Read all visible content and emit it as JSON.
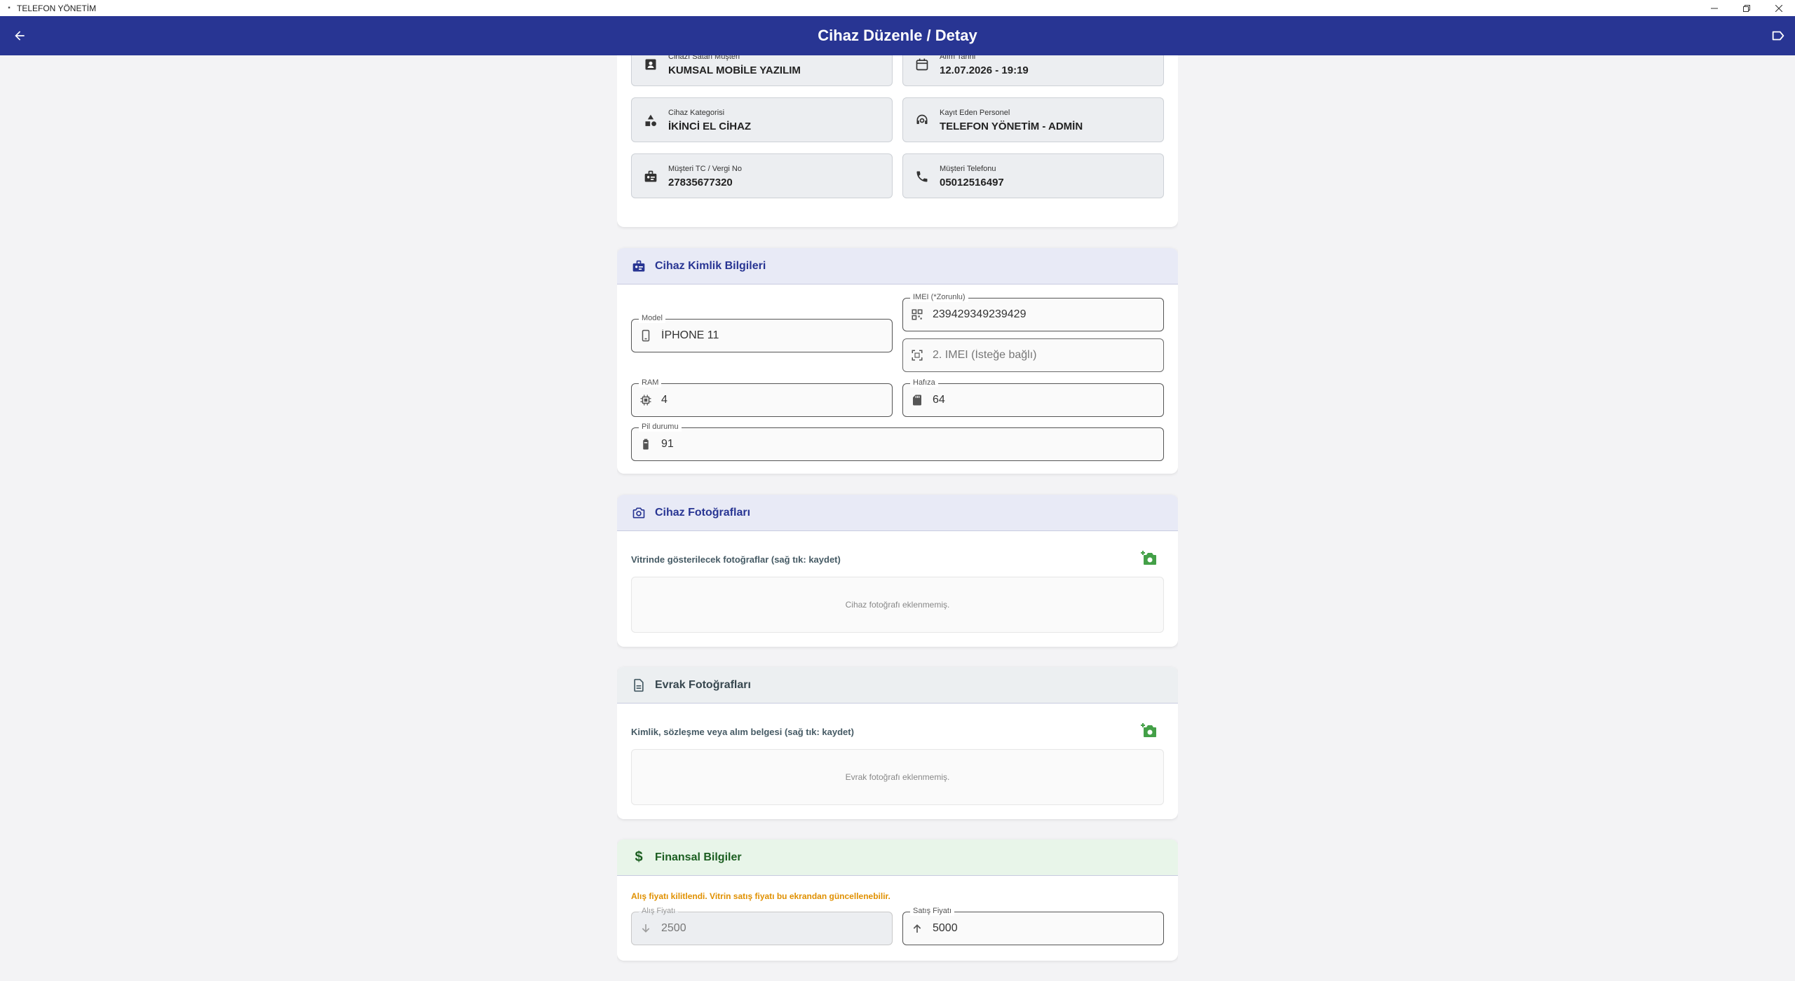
{
  "window": {
    "title": "TELEFON YÖNETİM"
  },
  "appbar": {
    "title": "Cihaz Düzenle / Detay"
  },
  "customer_info": [
    {
      "label": "Cihazı Satan Müşteri",
      "value": "KUMSAL MOBİLE YAZILIM",
      "icon": "contact-card-icon"
    },
    {
      "label": "Alım Tarihi",
      "value": "12.07.2026 - 19:19",
      "icon": "calendar-icon"
    },
    {
      "label": "Cihaz Kategorisi",
      "value": "İKİNCİ EL CİHAZ",
      "icon": "category-icon"
    },
    {
      "label": "Kayıt Eden Personel",
      "value": "TELEFON YÖNETİM - ADMİN",
      "icon": "support-agent-icon"
    },
    {
      "label": "Müşteri TC / Vergi No",
      "value": "27835677320",
      "icon": "id-badge-icon"
    },
    {
      "label": "Müşteri Telefonu",
      "value": "05012516497",
      "icon": "phone-icon"
    }
  ],
  "identity": {
    "title": "Cihaz Kimlik Bilgileri",
    "model": {
      "label": "Model",
      "value": "İPHONE 11"
    },
    "imei1": {
      "label": "IMEI (*Zorunlu)",
      "value": "239429349239429"
    },
    "imei2": {
      "placeholder": "2. IMEI (İsteğe bağlı)"
    },
    "ram": {
      "label": "RAM",
      "value": "4"
    },
    "storage": {
      "label": "Hafıza",
      "value": "64"
    },
    "battery": {
      "label": "Pil durumu",
      "value": "91"
    }
  },
  "device_photos": {
    "title": "Cihaz Fotoğrafları",
    "subtitle": "Vitrinde gösterilecek fotoğraflar (sağ tık: kaydet)",
    "empty": "Cihaz fotoğrafı eklenmemiş."
  },
  "document_photos": {
    "title": "Evrak Fotoğrafları",
    "subtitle": "Kimlik, sözleşme veya alım belgesi (sağ tık: kaydet)",
    "empty": "Evrak fotoğrafı eklenmemiş."
  },
  "finance": {
    "title": "Finansal Bilgiler",
    "warning": "Alış fiyatı kilitlendi. Vitrin satış fiyatı bu ekrandan güncellenebilir.",
    "buy": {
      "label": "Alış Fiyatı",
      "value": "2500"
    },
    "sell": {
      "label": "Satış Fiyatı",
      "value": "5000"
    }
  },
  "colors": {
    "primary": "#283593",
    "finance_green": "#1b5e20",
    "add_photo_green": "#43a047",
    "warning": "#e09000"
  }
}
